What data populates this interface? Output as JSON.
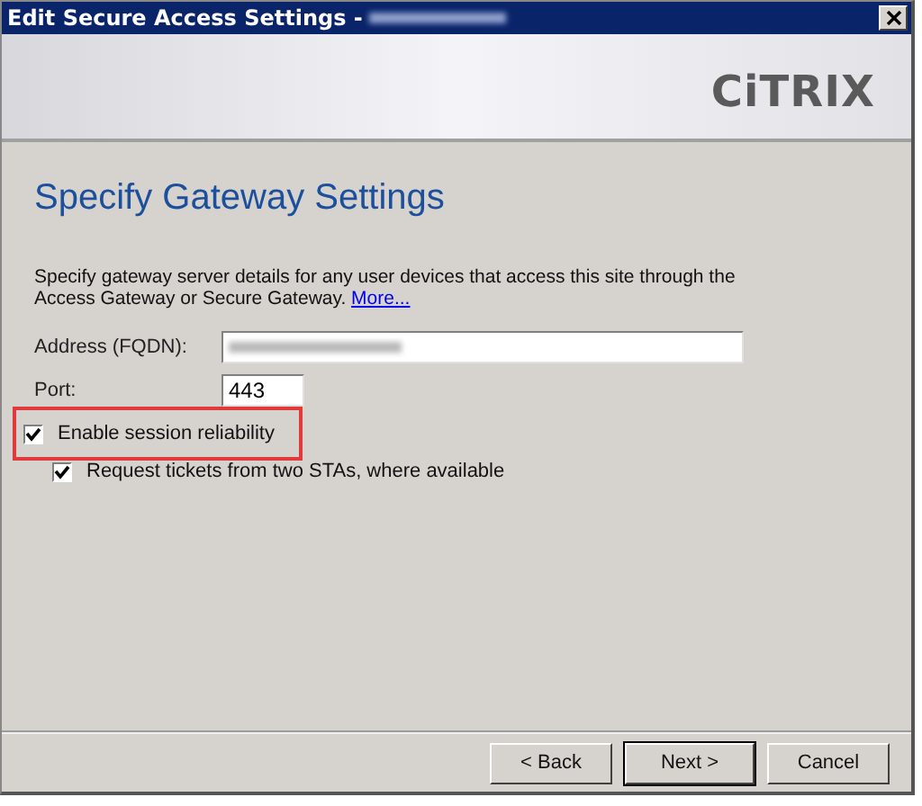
{
  "window": {
    "title": "Edit Secure Access Settings -"
  },
  "banner": {
    "logo": "CiTRIX"
  },
  "page": {
    "heading": "Specify Gateway Settings",
    "description": "Specify gateway server details for any user devices that access this site through the Access Gateway or Secure Gateway.",
    "link": "More..."
  },
  "fields": [
    {
      "label": "Address (FQDN):",
      "kind": "wide"
    },
    {
      "label": "Port:",
      "value": "443",
      "kind": "narrow"
    }
  ],
  "options": [
    {
      "label": "Enable session reliability",
      "checked": true,
      "highlighted": true,
      "children": [
        {
          "label": "Request tickets from two STAs, where available",
          "checked": true,
          "highlighted": false
        }
      ]
    }
  ],
  "buttons": [
    {
      "label": "< Back",
      "default": false
    },
    {
      "label": "Next >",
      "default": true
    },
    {
      "label": "Cancel",
      "default": false
    }
  ]
}
